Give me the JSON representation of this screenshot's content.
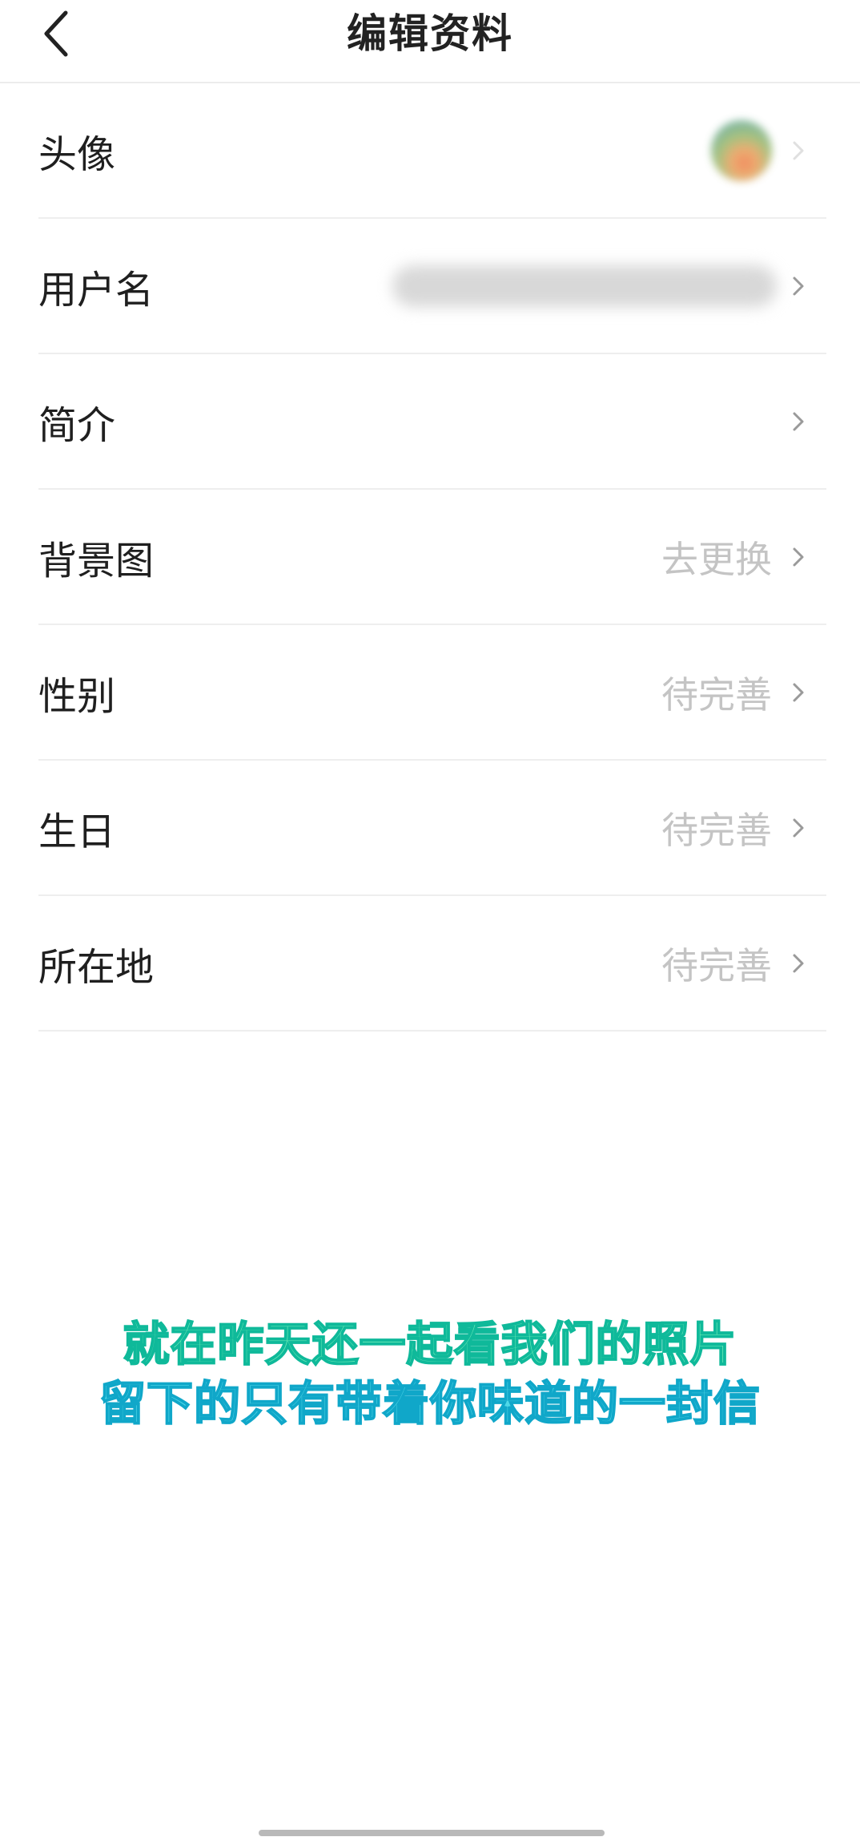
{
  "header": {
    "title": "编辑资料"
  },
  "rows": [
    {
      "label": "头像",
      "value": ""
    },
    {
      "label": "用户名",
      "value": ""
    },
    {
      "label": "简介",
      "value": ""
    },
    {
      "label": "背景图",
      "value": "去更换"
    },
    {
      "label": "性别",
      "value": "待完善"
    },
    {
      "label": "生日",
      "value": "待完善"
    },
    {
      "label": "所在地",
      "value": "待完善"
    }
  ],
  "subtitles": {
    "line1": "就在昨天还一起看我们的照片",
    "line2": "留下的只有带着你味道的一封信"
  },
  "icons": {
    "back": "chevron-left-icon",
    "row_arrow": "chevron-right-icon"
  },
  "colors": {
    "subtitle_line1": "#67e8b5",
    "subtitle_line2": "#4fd8e8",
    "value_text": "#c4c4c4"
  }
}
